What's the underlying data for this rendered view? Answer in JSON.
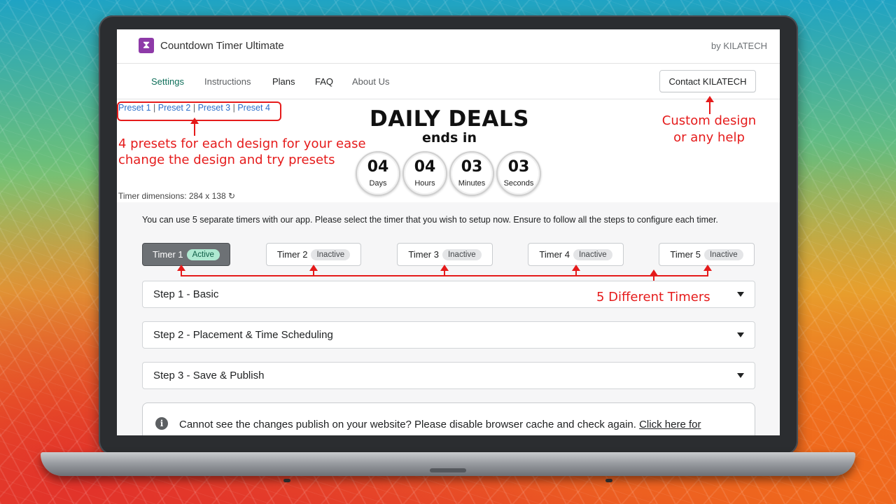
{
  "app": {
    "title": "Countdown Timer Ultimate",
    "vendor": "by KILATECH",
    "logo_glyph": "⧗"
  },
  "nav": {
    "tabs": [
      {
        "label": "Settings",
        "active": true
      },
      {
        "label": "Instructions"
      },
      {
        "label": "Plans"
      },
      {
        "label": "FAQ"
      },
      {
        "label": "About Us"
      }
    ],
    "contact_label": "Contact KILATECH"
  },
  "preview": {
    "presets": [
      "Preset 1",
      "Preset 2",
      "Preset 3",
      "Preset 4"
    ],
    "separator": "|",
    "headline": "DAILY DEALS",
    "subheadline": "ends in",
    "units": [
      {
        "value": "04",
        "label": "Days"
      },
      {
        "value": "04",
        "label": "Hours"
      },
      {
        "value": "03",
        "label": "Minutes"
      },
      {
        "value": "03",
        "label": "Seconds"
      }
    ],
    "dimensions": "Timer dimensions: 284 x 138",
    "refresh_glyph": "↻"
  },
  "annotations": {
    "presets_line1": "4 presets for each design for your ease",
    "presets_line2": "change the design and try presets",
    "custom_line1": "Custom design",
    "custom_line2": "or any help",
    "timers": "5 Different Timers",
    "color": "#e51b1b"
  },
  "settings": {
    "intro": "You can use 5 separate timers with our app. Please select the timer that you wish to setup now. Ensure to follow all the steps to configure each timer.",
    "timers": [
      {
        "label": "Timer 1",
        "status": "Active"
      },
      {
        "label": "Timer 2",
        "status": "Inactive"
      },
      {
        "label": "Timer 3",
        "status": "Inactive"
      },
      {
        "label": "Timer 4",
        "status": "Inactive"
      },
      {
        "label": "Timer 5",
        "status": "Inactive"
      }
    ],
    "steps": [
      "Step 1 - Basic",
      "Step 2 - Placement & Time Scheduling",
      "Step 3 - Save & Publish"
    ],
    "notice": "Cannot see the changes publish on your website? Please disable browser cache and check again.",
    "notice_link": "Click here for instructions?"
  },
  "colors": {
    "active_tab": "#0f6f5a",
    "active_badge": "#aee9d1",
    "link": "#2c6ecb"
  }
}
